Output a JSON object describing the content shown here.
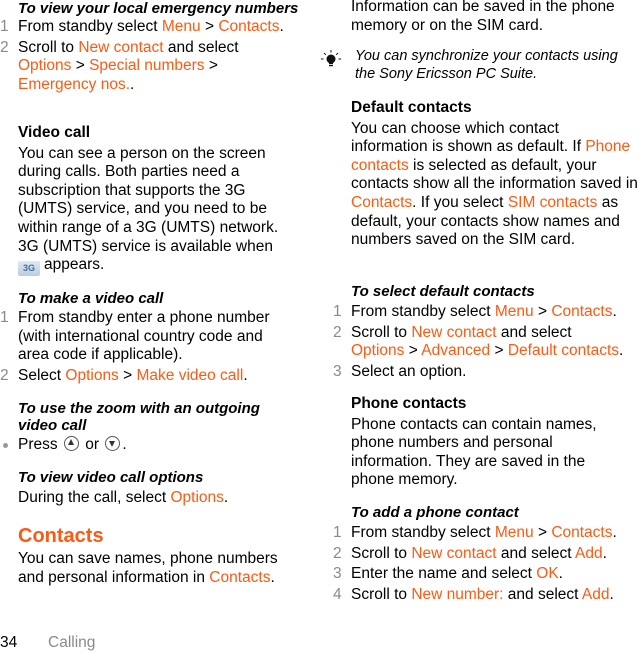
{
  "left": {
    "emergency": {
      "heading": "To view your local emergency numbers",
      "step1": {
        "num": "1",
        "t1": "From standby select ",
        "l1": "Menu",
        "t2": " > ",
        "l2": "Contacts",
        "t3": "."
      },
      "step2": {
        "num": "2",
        "t1": "Scroll to ",
        "l1": "New contact",
        "t2": " and select ",
        "l2": "Options",
        "t3": " > ",
        "l3": "Special numbers",
        "t4": " > ",
        "l4": "Emergency nos.",
        "t5": "."
      }
    },
    "video_call": {
      "heading": "Video call",
      "body": "You can see a person on the screen during calls. Both parties need a subscription that supports the 3G (UMTS) service, and you need to be within range of a 3G (UMTS) network. 3G (UMTS) service is available when",
      "icon_label": "3G",
      "body_end": "appears."
    },
    "make_video_call": {
      "heading": "To make a video call",
      "step1": {
        "num": "1",
        "text": "From standby enter a phone number (with international country code and area code if applicable)."
      },
      "step2": {
        "num": "2",
        "t1": "Select ",
        "l1": "Options",
        "t2": " > ",
        "l2": "Make video call",
        "t3": "."
      }
    },
    "zoom": {
      "heading": "To use the zoom with an outgoing video call",
      "t1": "Press ",
      "t2": " or ",
      "t3": "."
    },
    "options": {
      "heading": "To view video call options",
      "t1": "During the call, select ",
      "l1": "Options",
      "t2": "."
    },
    "contacts": {
      "heading": "Contacts",
      "t1": "You can save names, phone numbers and personal information in ",
      "l1": "Contacts",
      "t2": "."
    }
  },
  "right": {
    "intro": "Information can be saved in the phone memory or on the SIM card.",
    "tip": "You can synchronize your contacts using the Sony Ericsson PC Suite.",
    "default_contacts": {
      "heading": "Default contacts",
      "t1": "You can choose which contact information is shown as default. If ",
      "l1": "Phone contacts",
      "t2": " is selected as default, your contacts show all the information saved in ",
      "l2": "Contacts",
      "t3": ". If you select ",
      "l3": "SIM contacts",
      "t4": " as default, your contacts show names and numbers saved on the SIM card."
    },
    "select_default": {
      "heading": "To select default contacts",
      "step1": {
        "num": "1",
        "t1": "From standby select ",
        "l1": "Menu",
        "t2": " > ",
        "l2": "Contacts",
        "t3": "."
      },
      "step2": {
        "num": "2",
        "t1": "Scroll to ",
        "l1": "New contact",
        "t2": " and select ",
        "l2": "Options",
        "t3": " > ",
        "l3": "Advanced",
        "t4": " > ",
        "l4": "Default contacts",
        "t5": "."
      },
      "step3": {
        "num": "3",
        "text": "Select an option."
      }
    },
    "phone_contacts": {
      "heading": "Phone contacts",
      "body": "Phone contacts can contain names, phone numbers and personal information. They are saved in the phone memory."
    },
    "add_contact": {
      "heading": "To add a phone contact",
      "step1": {
        "num": "1",
        "t1": "From standby select ",
        "l1": "Menu",
        "t2": " > ",
        "l2": "Contacts",
        "t3": "."
      },
      "step2": {
        "num": "2",
        "t1": "Scroll to ",
        "l1": "New contact",
        "t2": " and select ",
        "l2": "Add",
        "t3": "."
      },
      "step3": {
        "num": "3",
        "t1": "Enter the name and select ",
        "l1": "OK",
        "t2": "."
      },
      "step4": {
        "num": "4",
        "t1": "Scroll to ",
        "l1": "New number:",
        "t2": " and select ",
        "l2": "Add",
        "t3": "."
      }
    }
  },
  "footer": {
    "page_number": "34",
    "section": "Calling"
  },
  "colors": {
    "link": "#ff5a14",
    "step_number": "#8a8a8a",
    "text": "#000000"
  }
}
